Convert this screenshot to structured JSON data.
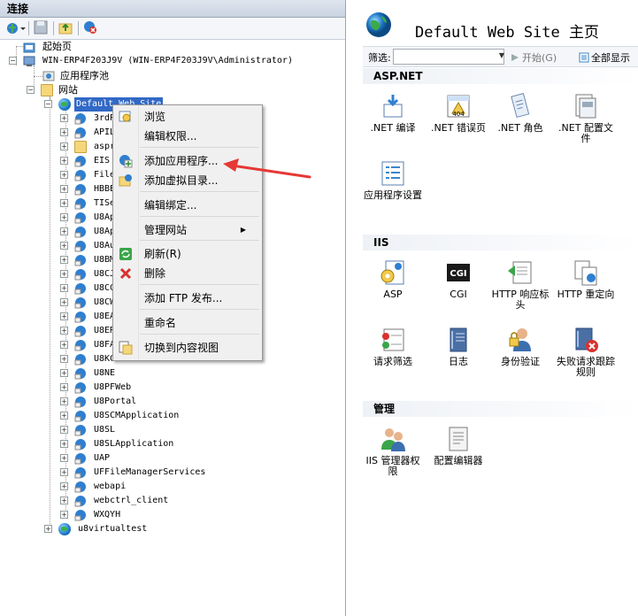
{
  "connections": {
    "title": "连接",
    "toolbar": [
      "connect-icon",
      "save-icon",
      "up-icon",
      "disconnect-icon"
    ],
    "tree": {
      "start_page": "起始页",
      "server": "WIN-ERP4F203J9V (WIN-ERP4F203J9V\\Administrator)",
      "app_pools": "应用程序池",
      "sites": "网站",
      "default_site": "Default Web Site",
      "children": [
        "3rdP",
        "APIL",
        "aspr",
        "EIS",
        "File",
        "HBBE",
        "TISe",
        "U8Ap",
        "U8Ap",
        "U8Au",
        "U8BM",
        "U8CJ",
        "U8CC",
        "U8CW",
        "U8EA",
        "U8ER",
        "U8FA",
        "U8KCSH",
        "U8NE",
        "U8PFWeb",
        "U8Portal",
        "U8SCMApplication",
        "U8SL",
        "U8SLApplication",
        "UAP",
        "UFFileManagerServices",
        "webapi",
        "webctrl_client",
        "WXQYH"
      ],
      "other_site": "u8virtualtest"
    }
  },
  "context_menu": {
    "items": [
      {
        "label": "浏览",
        "icon": "browse-icon"
      },
      {
        "label": "编辑权限...",
        "icon": ""
      },
      {
        "label": "添加应用程序...",
        "icon": "add-app-icon"
      },
      {
        "label": "添加虚拟目录...",
        "icon": "add-vdir-icon"
      },
      {
        "label": "编辑绑定...",
        "icon": ""
      },
      {
        "label": "管理网站",
        "icon": "",
        "submenu": true
      },
      {
        "label": "刷新(R)",
        "icon": "refresh-icon"
      },
      {
        "label": "删除",
        "icon": "delete-icon"
      },
      {
        "label": "添加 FTP 发布...",
        "icon": ""
      },
      {
        "label": "重命名",
        "icon": ""
      },
      {
        "label": "切换到内容视图",
        "icon": "content-view-icon"
      }
    ]
  },
  "main": {
    "title": "Default Web Site 主页",
    "filter_label": "筛选:",
    "go_label": "开始(G)",
    "show_all_label": "全部显示",
    "groups": [
      {
        "name": "ASP.NET",
        "features": [
          {
            "label": ".NET 编译",
            "icon": "compile-icon"
          },
          {
            "label": ".NET 错误页",
            "icon": "error-page-icon"
          },
          {
            "label": ".NET 角色",
            "icon": "roles-icon"
          },
          {
            "label": ".NET 配置文件",
            "icon": "profile-icon"
          },
          {
            "label": "应用程序设置",
            "icon": "app-settings-icon"
          }
        ]
      },
      {
        "name": "IIS",
        "features": [
          {
            "label": "ASP",
            "icon": "asp-icon"
          },
          {
            "label": "CGI",
            "icon": "cgi-icon"
          },
          {
            "label": "HTTP 响应标头",
            "icon": "response-headers-icon"
          },
          {
            "label": "HTTP 重定向",
            "icon": "redirect-icon"
          },
          {
            "label": "请求筛选",
            "icon": "request-filter-icon"
          },
          {
            "label": "日志",
            "icon": "logging-icon"
          },
          {
            "label": "身份验证",
            "icon": "auth-icon"
          },
          {
            "label": "失败请求跟踪规则",
            "icon": "failed-trace-icon"
          }
        ]
      },
      {
        "name": "管理",
        "features": [
          {
            "label": "IIS 管理器权限",
            "icon": "mgr-permissions-icon"
          },
          {
            "label": "配置编辑器",
            "icon": "config-editor-icon"
          }
        ]
      }
    ]
  },
  "colors": {
    "selection": "#3169c6",
    "arrow": "#e53935"
  }
}
